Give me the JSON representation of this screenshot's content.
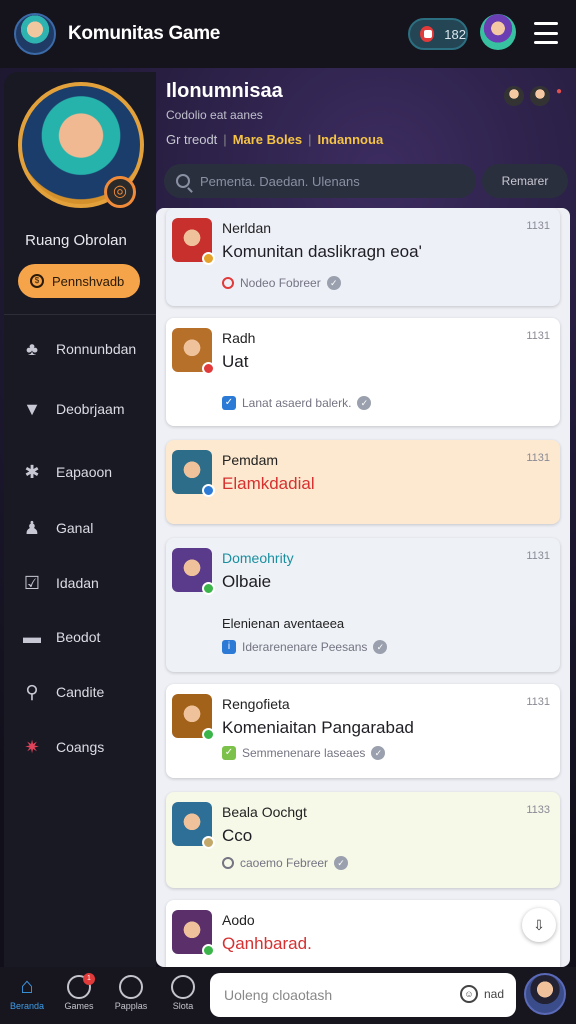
{
  "header": {
    "app_title": "Komunitas Game",
    "notif_label": "182"
  },
  "sidebar": {
    "profile_name": "Ruang Obrolan",
    "profile_button": "Pennshvadb",
    "items": [
      {
        "label": "Ronnunbdan",
        "icon": "users-icon"
      },
      {
        "label": "Deobrjaam",
        "icon": "shield-icon"
      },
      {
        "label": "Eapaoon",
        "icon": "gear-icon"
      },
      {
        "label": "Ganal",
        "icon": "profile-icon"
      },
      {
        "label": "Idadan",
        "icon": "inbox-icon"
      },
      {
        "label": "Beodot",
        "icon": "store-icon"
      },
      {
        "label": "Candite",
        "icon": "search-icon"
      },
      {
        "label": "Coangs",
        "icon": "star-icon"
      }
    ]
  },
  "main": {
    "title": "Ilonumnisaa",
    "subtitle": "Codolio eat aanes",
    "filters": [
      {
        "label": "Gr treodt",
        "active": false
      },
      {
        "label": "Mare Boles",
        "active": true
      },
      {
        "label": "Indannoua",
        "active": true
      }
    ],
    "search_placeholder": "Pementa. Daedan. Ulenans",
    "refresh_label": "Remarer",
    "messages": [
      {
        "name": "Nerldan",
        "text": "Komunitan daslikragn eoa'",
        "time": "1131",
        "meta": "Nodeo Fobreer",
        "bg": "#eef0f8",
        "avatar": "#c8302e"
      },
      {
        "name": "Radh",
        "text": "Uat",
        "time": "1131",
        "meta": "Lanat asaerd balerk.",
        "bg": "#ffffff",
        "avatar": "#b7702a"
      },
      {
        "name": "Pemdam",
        "text": "Elamkdadial",
        "time": "1131",
        "meta": "",
        "bg": "#fde9cf",
        "avatar": "#2d6d8a",
        "red": true
      },
      {
        "name": "Domeohrity",
        "text": "Olbaie",
        "time": "1131",
        "note": "Elenienan aventaeea",
        "meta": "Iderarenenare Peesans",
        "bg": "#eef1f6",
        "avatar": "#5a3a8a"
      },
      {
        "name": "Rengofieta",
        "text": "Komeniaitan Pangarabad",
        "time": "1131",
        "meta": "Semmenenare laseaes",
        "bg": "#ffffff",
        "avatar": "#a2621a"
      },
      {
        "name": "Beala Oochgt",
        "text": "Cco",
        "time": "1133",
        "meta": "caoemo Febreer",
        "bg": "#f6f8e8",
        "avatar": "#2e6f98"
      },
      {
        "name": "Aodo",
        "text": "Qanhbarad.",
        "time": "",
        "meta": "",
        "bg": "#ffffff",
        "avatar": "#5a2f6a",
        "red": true
      }
    ]
  },
  "bottom": {
    "nav": [
      {
        "label": "Beranda",
        "active": true
      },
      {
        "label": "Games",
        "active": false,
        "badge": "1"
      },
      {
        "label": "Papplas",
        "active": false
      },
      {
        "label": "Slota",
        "active": false
      }
    ],
    "chat_placeholder": "Uoleng cloaotash",
    "send_label": "nad"
  }
}
